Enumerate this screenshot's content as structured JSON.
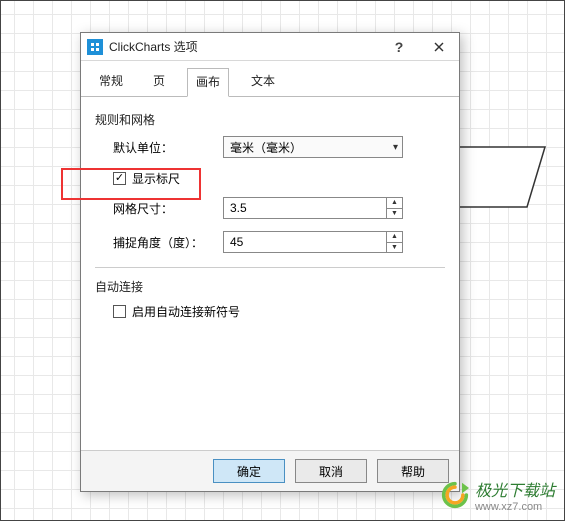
{
  "dialog": {
    "title": "ClickCharts 选项",
    "tabs": [
      "常规",
      "页",
      "画布",
      "文本"
    ],
    "active_tab": 2,
    "group_rules": "规则和网格",
    "default_unit_label": "默认单位：",
    "default_unit_value": "毫米（毫米）",
    "show_rulers_label": "显示标尺",
    "show_rulers_checked": true,
    "grid_size_label": "网格尺寸：",
    "grid_size_value": "3.5",
    "snap_angle_label": "捕捉角度（度）：",
    "snap_angle_value": "45",
    "group_autoconnect": "自动连接",
    "autoconnect_label": "启用自动连接新符号",
    "autoconnect_checked": false
  },
  "footer": {
    "ok": "确定",
    "cancel": "取消",
    "help": "帮助"
  },
  "watermark": {
    "name": "极光下载站",
    "url": "www.xz7.com"
  }
}
